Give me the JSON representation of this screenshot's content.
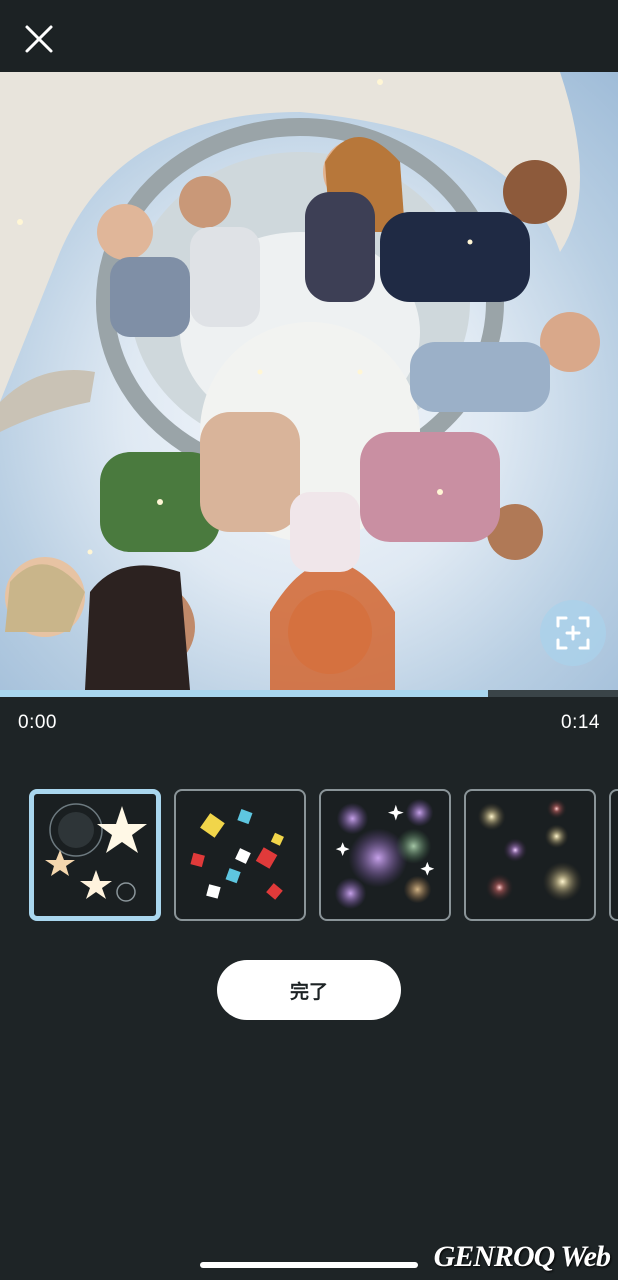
{
  "toolbar": {
    "close_icon": "close-icon"
  },
  "preview": {
    "description_icon": "tiny-planet-360-photo",
    "crop_icon": "reframe-add-icon"
  },
  "playback": {
    "time_start": "0:00",
    "time_end": "0:14",
    "progress_fraction": 0.79
  },
  "effects": {
    "items": [
      {
        "name": "stars",
        "selected": true
      },
      {
        "name": "confetti",
        "selected": false
      },
      {
        "name": "bokeh-sparkle",
        "selected": false
      },
      {
        "name": "glow-dots",
        "selected": false
      }
    ]
  },
  "actions": {
    "done_label": "完了"
  },
  "watermark": {
    "text": "GENROQ Web"
  },
  "colors": {
    "accent": "#a9d6ee",
    "background": "#1e2426"
  }
}
